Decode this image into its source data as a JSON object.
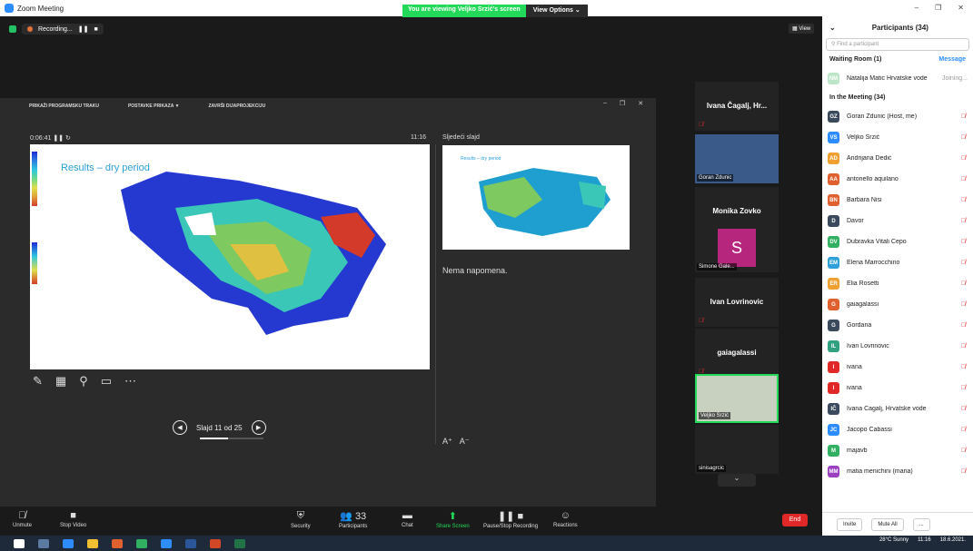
{
  "window": {
    "title": "Zoom Meeting"
  },
  "banner": {
    "viewing": "You are viewing Veljko Srzić's screen",
    "view_options": "View Options ⌄"
  },
  "recording": {
    "label": "Recording...",
    "view_label": "View"
  },
  "ppt": {
    "toolbar": [
      "PRIKAŽI PROGRAMSKU TRAKU",
      "POSTAVKE PRIKAZA ▼",
      "ZAVRŠI DIJAPROJEKCIJU"
    ],
    "timer": "0:06:41",
    "clock": "11:16",
    "next_label": "Sljedeći slajd",
    "slide_title": "Results – dry period",
    "next_title": "Results – dry period",
    "notes": "Nema napomena.",
    "nav": "Slajd 11 od 25",
    "slide_progress": 0.44
  },
  "gallery": [
    {
      "name": "Ivana Čagalj, Hr...",
      "muted": true
    },
    {
      "name": "Goran Zdunic",
      "tag": true
    },
    {
      "name": "Monika Zovko",
      "muted": true
    },
    {
      "name": "Simone Gale...",
      "initial": "S",
      "tag": true
    },
    {
      "name": "Ivan Lovrinovic",
      "muted": true
    },
    {
      "name": "gaiagalassi",
      "muted": true
    },
    {
      "name": "Veljko Srzić",
      "tag": true
    },
    {
      "name": "sinisagrcic",
      "tag": true
    }
  ],
  "bottombar": {
    "unmute": "Unmute",
    "stop_video": "Stop Video",
    "security": "Security",
    "participants": "Participants",
    "participants_count": "33",
    "chat": "Chat",
    "share": "Share Screen",
    "record": "Pause/Stop Recording",
    "reactions": "Reactions",
    "end": "End"
  },
  "panel": {
    "title": "Participants (34)",
    "search_placeholder": "Find a participant",
    "waiting_room": "Waiting Room (1)",
    "message": "Message",
    "waiting": {
      "initials": "NM",
      "name": "Natalija Matic Hrvatske vode",
      "status": "Joining..."
    },
    "in_meeting": "In the Meeting (34)",
    "invite": "Invite",
    "mute_all": "Mute All",
    "more": "..."
  },
  "participants": [
    {
      "initials": "GZ",
      "name": "Goran Zdunic (Host, me)",
      "color": "#3a4a5c"
    },
    {
      "initials": "VS",
      "name": "Veljko Srzić",
      "color": "#2d8cff"
    },
    {
      "initials": "AD",
      "name": "Andrijana Dedić",
      "color": "#f0a030"
    },
    {
      "initials": "AA",
      "name": "antonello aquilano",
      "color": "#e06030"
    },
    {
      "initials": "BN",
      "name": "Barbara Nisi",
      "color": "#e06030"
    },
    {
      "initials": "D",
      "name": "Davor",
      "color": "#3a4a5c"
    },
    {
      "initials": "DV",
      "name": "Dubravka Vitali Čepo",
      "color": "#30b060"
    },
    {
      "initials": "EM",
      "name": "Elena Marrocchino",
      "color": "#2d9fd9"
    },
    {
      "initials": "ER",
      "name": "Elia Rosetti",
      "color": "#f0a030"
    },
    {
      "initials": "G",
      "name": "gaiagalassi",
      "color": "#e06030"
    },
    {
      "initials": "G",
      "name": "Gordana",
      "color": "#3a4a5c"
    },
    {
      "initials": "IL",
      "name": "Ivan Lovrinovic",
      "color": "#30a080"
    },
    {
      "initials": "I",
      "name": "ivana",
      "color": "#e02828"
    },
    {
      "initials": "I",
      "name": "ivana",
      "color": "#e02828"
    },
    {
      "initials": "IČ",
      "name": "Ivana Čagalj, Hrvatske vode",
      "color": "#3a4a5c"
    },
    {
      "initials": "JC",
      "name": "Jacopo Cabassi",
      "color": "#2d8cff"
    },
    {
      "initials": "M",
      "name": "majavb",
      "color": "#30b060"
    },
    {
      "initials": "MM",
      "name": "matia menichini (maria)",
      "color": "#9a40c0"
    }
  ],
  "taskbar": {
    "weather": "28°C Sunny",
    "time": "11:16",
    "date": "18.6.2021."
  }
}
